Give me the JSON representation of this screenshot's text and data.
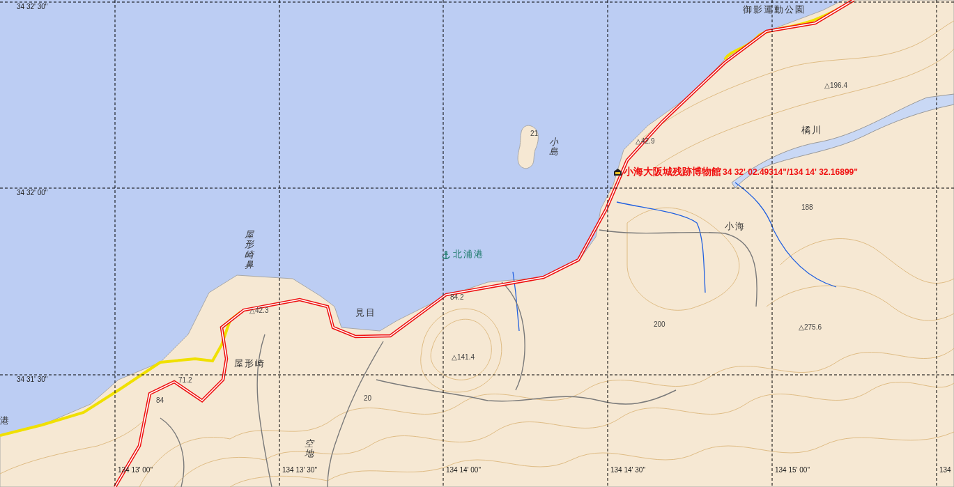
{
  "map": {
    "latitude_labels": [
      "34 32' 30\"",
      "34 32' 00\"",
      "34 31' 30\""
    ],
    "longitude_labels": [
      "134 13' 00\"",
      "134 13' 30\"",
      "134 14' 00\"",
      "134 14' 30\"",
      "134 15' 00\"",
      "134"
    ],
    "place_labels": [
      {
        "text": "御影運動公園",
        "kind": "horizontal"
      },
      {
        "text": "小島",
        "kind": "vertical"
      },
      {
        "text": "橘川",
        "kind": "horizontal"
      },
      {
        "text": "小海",
        "kind": "horizontal"
      },
      {
        "text": "北浦港",
        "kind": "harbor"
      },
      {
        "text": "屋形崎鼻",
        "kind": "vertical"
      },
      {
        "text": "見目",
        "kind": "horizontal"
      },
      {
        "text": "屋形崎",
        "kind": "horizontal"
      },
      {
        "text": "空地",
        "kind": "vertical"
      },
      {
        "text": "港",
        "kind": "horizontal"
      }
    ],
    "elevation_labels": [
      {
        "text": "△196.4"
      },
      {
        "text": "△42.9"
      },
      {
        "text": "21"
      },
      {
        "text": "188"
      },
      {
        "text": "200"
      },
      {
        "text": "△275.6"
      },
      {
        "text": "△141.4"
      },
      {
        "text": "△42.3"
      },
      {
        "text": "84.2"
      },
      {
        "text": "71.2"
      },
      {
        "text": "84"
      },
      {
        "text": "20"
      }
    ],
    "museum_marker": {
      "name": "小海大阪城残跡博物館",
      "coordinates": "34 32' 02.49314\"/134 14' 32.16899\""
    }
  }
}
